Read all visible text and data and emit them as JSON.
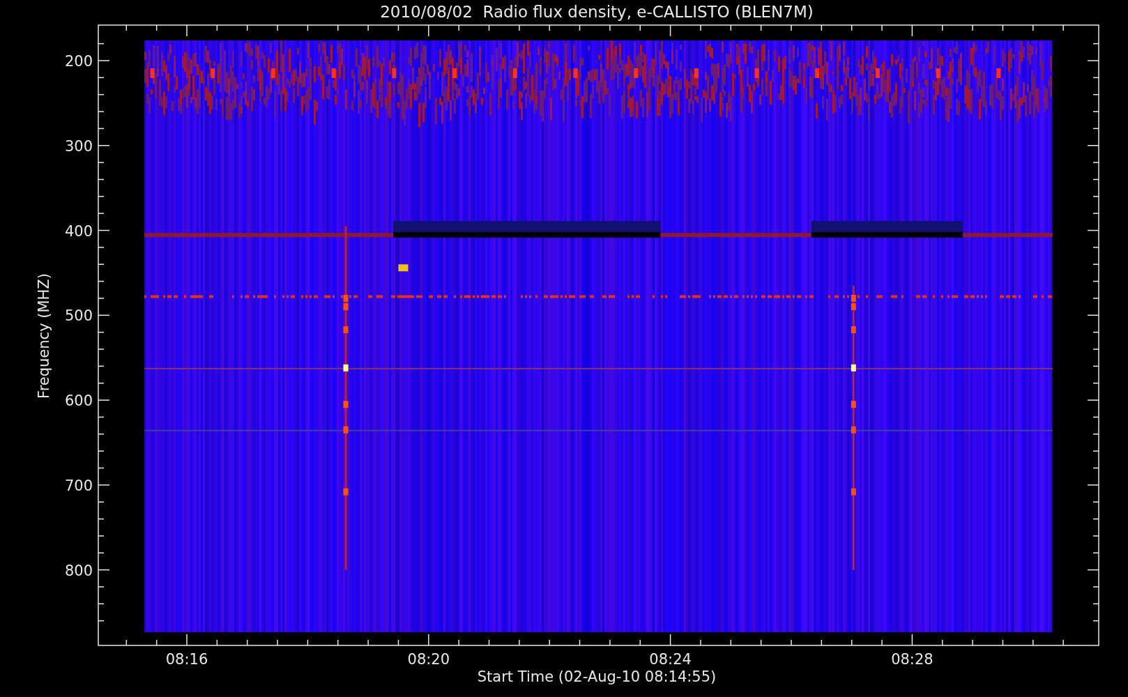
{
  "title": "2010/08/02  Radio flux density, e-CALLISTO (BLEN7M)",
  "y_axis": {
    "label": "Frequency (MHZ)",
    "ticks": [
      "200",
      "300",
      "400",
      "500",
      "600",
      "700",
      "800"
    ]
  },
  "x_axis": {
    "label": "Start Time (02-Aug-10 08:14:55)",
    "ticks": [
      "08:16",
      "08:20",
      "08:24",
      "08:28"
    ]
  }
}
